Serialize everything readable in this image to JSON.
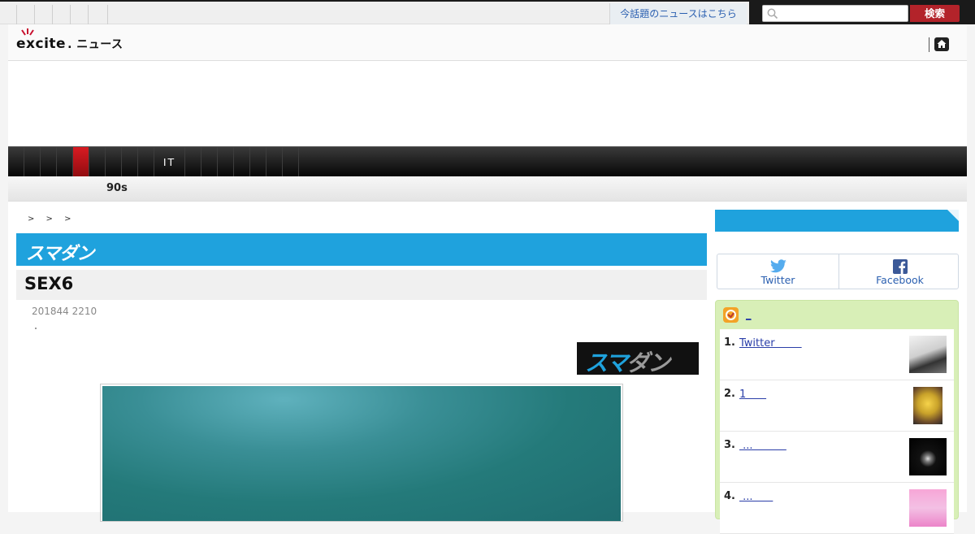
{
  "topbar": {
    "trend_link": "今話題のニュースはこちら",
    "search_placeholder": "",
    "search_button": "検索"
  },
  "header": {
    "logo_text": "excite",
    "logo_sub": ". ニュース"
  },
  "category_nav": {
    "it_label": "IT"
  },
  "sub_nav": {
    "label": "90s"
  },
  "breadcrumb": "> > >",
  "article": {
    "site_banner": "スマダン",
    "title": "SEX6",
    "date": "201844 2210",
    "source_logo_blue": "スマ",
    "source_logo_grey": "ダン"
  },
  "share": {
    "twitter": "Twitter",
    "facebook": "Facebook"
  },
  "ranking": {
    "head_link": " _",
    "items": [
      {
        "num": "1.",
        "title": "Twitter        "
      },
      {
        "num": "2.",
        "title": "1      "
      },
      {
        "num": "3.",
        "title": " ...          "
      },
      {
        "num": "4.",
        "title": " ...      "
      }
    ]
  },
  "colors": {
    "accent_blue": "#1fa2dd",
    "search_red": "#b3232a",
    "nav_active_red": "#d81b22",
    "ranking_green": "#d8efb7"
  }
}
